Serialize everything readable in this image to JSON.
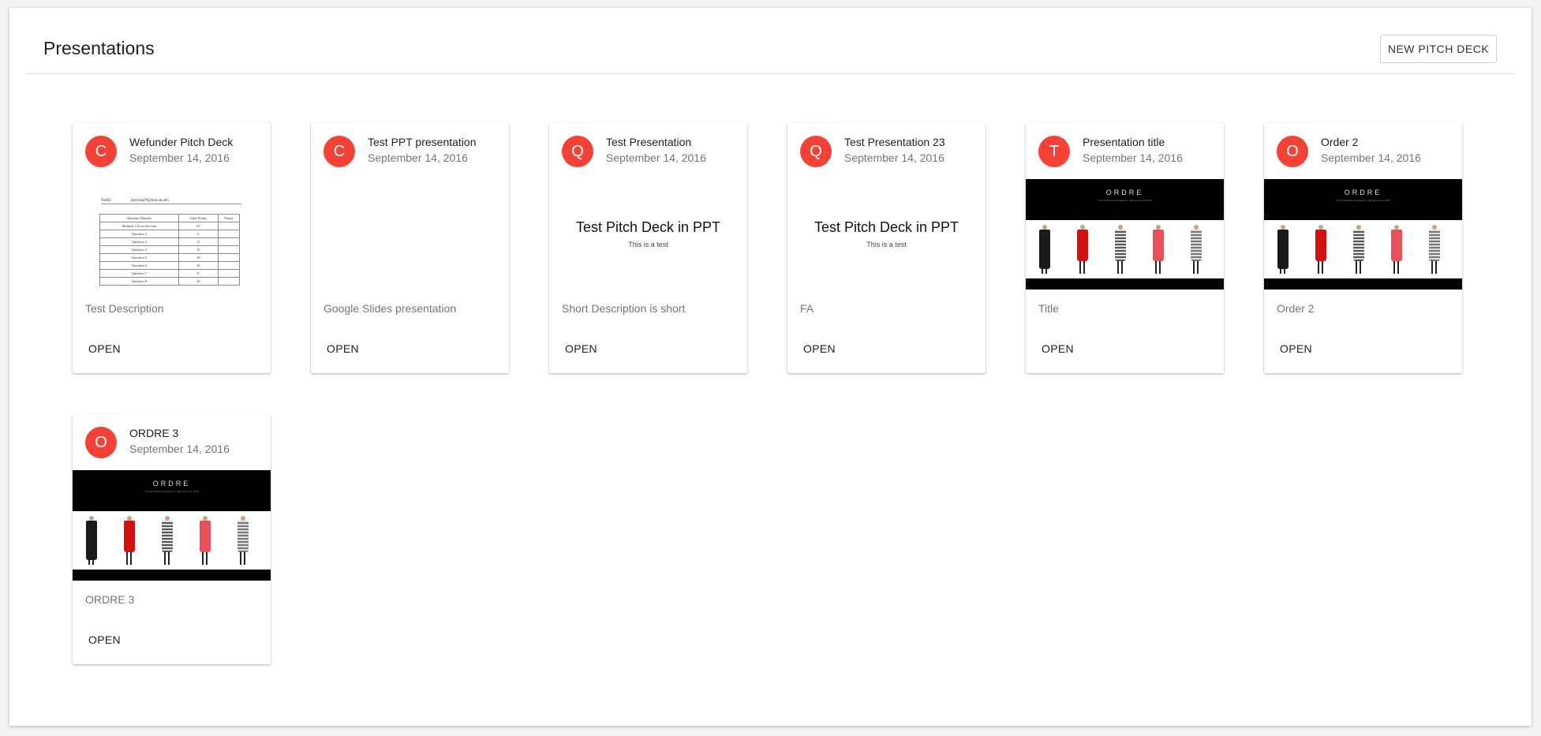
{
  "header": {
    "title": "Presentations",
    "new_button": "NEW PITCH DECK"
  },
  "colors": {
    "avatar": "#f44336"
  },
  "thumb_text": {
    "table_head_left": "NetID:",
    "table_head_right": "kprytle@#@lmicah.edu",
    "table_header": [
      "Question Number",
      "Total Points",
      "Points"
    ],
    "table_rows": [
      [
        "Multiple Choice Section",
        "25",
        ""
      ],
      [
        "Question 2",
        "6",
        ""
      ],
      [
        "Question 3",
        "12",
        ""
      ],
      [
        "Question 4",
        "10",
        ""
      ],
      [
        "Question 5",
        "10",
        ""
      ],
      [
        "Question 6",
        "16",
        ""
      ],
      [
        "Question 7",
        "8",
        ""
      ],
      [
        "Question 8",
        "10",
        ""
      ]
    ],
    "ppt_title": "Test Pitch Deck in PPT",
    "ppt_sub": "This is a test",
    "ordre_logo": "ORDRE",
    "ordre_tag": "Art and Wellness Intelligence. Spring/summer 2016"
  },
  "cards": [
    {
      "avatar": "C",
      "title": "Wefunder Pitch Deck",
      "date": "September 14, 2016",
      "description": "Test Description",
      "thumb": "table",
      "open": "OPEN"
    },
    {
      "avatar": "C",
      "title": "Test PPT presentation",
      "date": "September 14, 2016",
      "description": "Google Slides presentation",
      "thumb": "blank",
      "open": "OPEN"
    },
    {
      "avatar": "Q",
      "title": "Test Presentation",
      "date": "September 14, 2016",
      "description": "Short Description is short",
      "thumb": "ppt",
      "open": "OPEN"
    },
    {
      "avatar": "Q",
      "title": "Test Presentation 23",
      "date": "September 14, 2016",
      "description": "FA",
      "thumb": "ppt",
      "open": "OPEN"
    },
    {
      "avatar": "T",
      "title": "Presentation title",
      "date": "September 14, 2016",
      "description": "Title",
      "thumb": "ordre",
      "open": "OPEN"
    },
    {
      "avatar": "O",
      "title": "Order 2",
      "date": "September 14, 2016",
      "description": "Order 2",
      "thumb": "ordre",
      "open": "OPEN"
    },
    {
      "avatar": "O",
      "title": "ORDRE 3",
      "date": "September 14, 2016",
      "description": "ORDRE 3",
      "thumb": "ordre",
      "open": "OPEN"
    }
  ]
}
